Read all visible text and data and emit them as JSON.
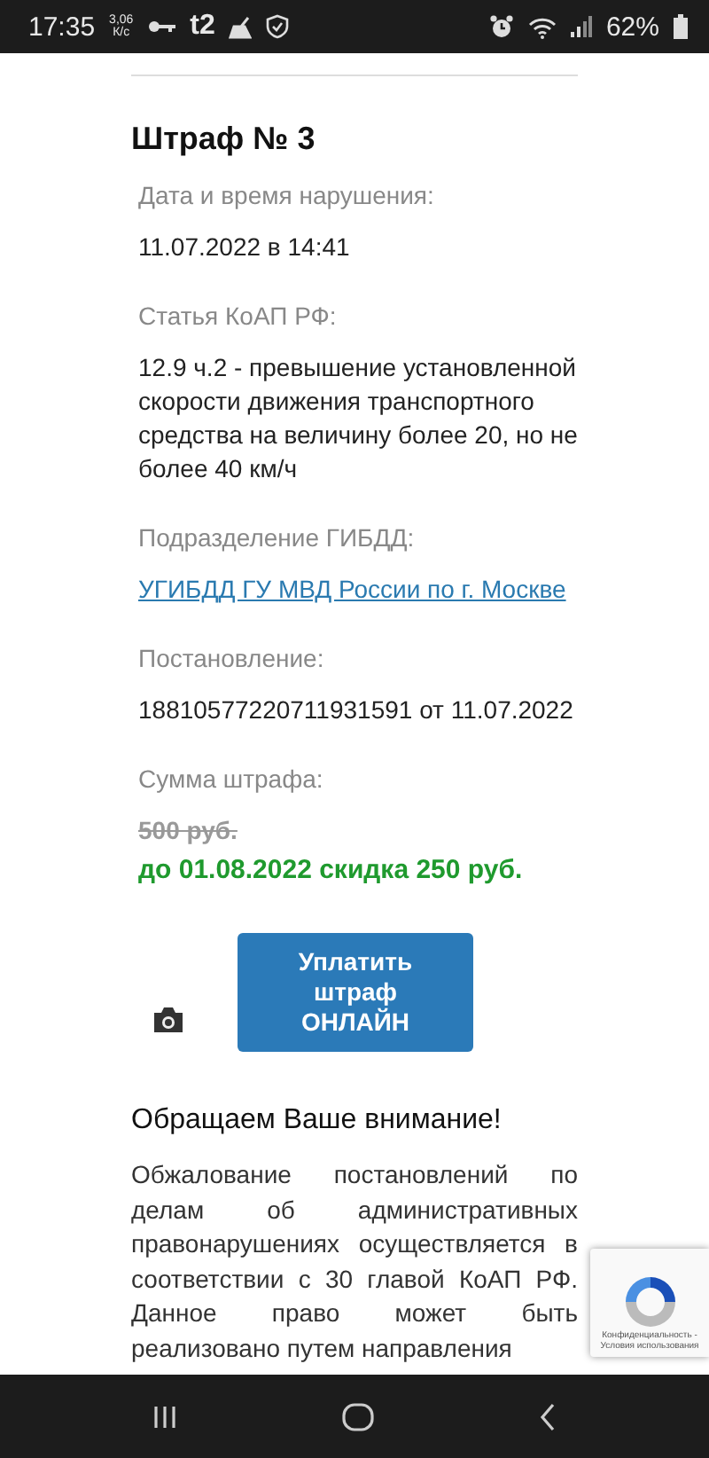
{
  "status_bar": {
    "time": "17:35",
    "speed": "3,06",
    "speed_unit": "К/с",
    "carrier": "t2",
    "battery": "62%"
  },
  "fine": {
    "title": "Штраф № 3",
    "fields": [
      {
        "kind": "text",
        "label": "Дата и время нарушения:",
        "value": "11.07.2022 в 14:41"
      },
      {
        "kind": "text",
        "label": "Статья КоАП РФ:",
        "value": "12.9 ч.2 - превышение установленной скорости движения транспортного средства на величину более 20, но не более 40 км/ч"
      },
      {
        "kind": "link",
        "label": "Подразделение ГИБДД:",
        "value": "УГИБДД ГУ МВД России по г. Москве"
      },
      {
        "kind": "text",
        "label": "Постановление:",
        "value": "18810577220711931591 от 11.07.2022"
      }
    ],
    "amount_label": "Сумма штрафа:",
    "old_amount": "500 руб.",
    "discount": "до 01.08.2022 скидка 250 руб.",
    "pay_button": "Уплатить штраф ОНЛАЙН"
  },
  "notice": {
    "title": "Обращаем Ваше внимание!",
    "text": "Обжалование постановлений по делам об административных правонарушениях осуществляется в соответствии с 30 главой КоАП РФ. Данное право может быть реализовано путем направления"
  },
  "recaptcha": {
    "links": "Конфиденциальность - Условия использования"
  }
}
